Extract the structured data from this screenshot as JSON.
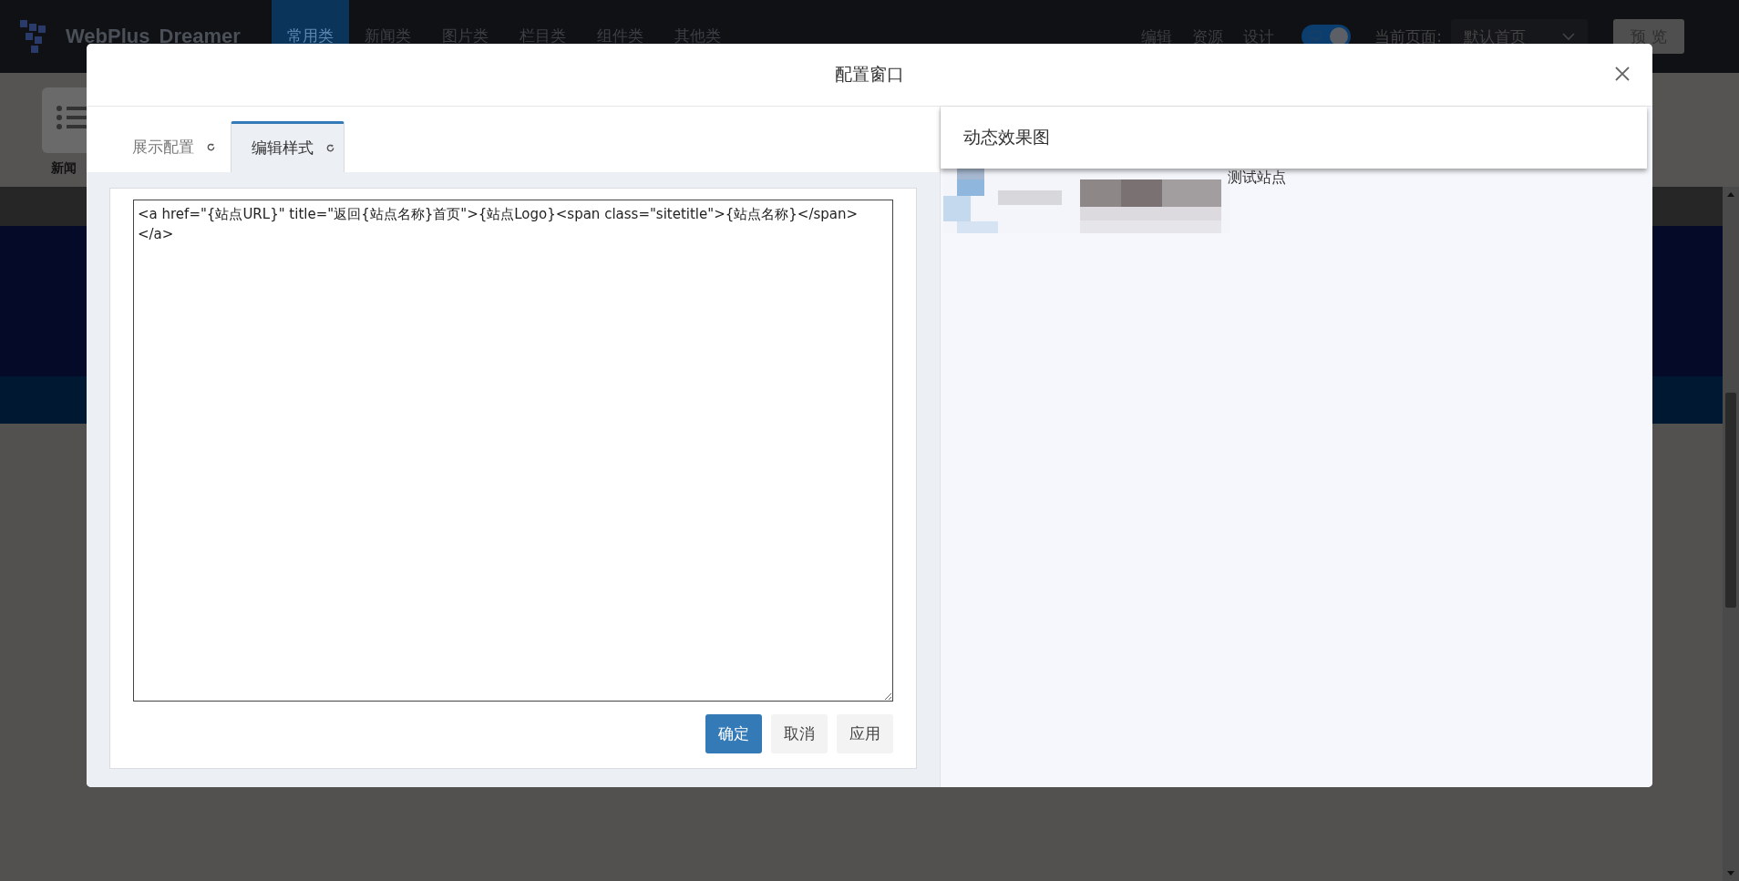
{
  "app_bar": {
    "logo_words": [
      "WebPlus",
      "Dreamer"
    ],
    "nav": [
      {
        "label": "常用类",
        "selected": true
      },
      {
        "label": "新闻类",
        "selected": false
      },
      {
        "label": "图片类",
        "selected": false
      },
      {
        "label": "栏目类",
        "selected": false
      },
      {
        "label": "组件类",
        "selected": false
      },
      {
        "label": "其他类",
        "selected": false
      }
    ],
    "actions": [
      "编辑",
      "资源",
      "设计"
    ],
    "toggle": {
      "on": true
    },
    "page_label": "当前页面:",
    "page_select": "默认首页",
    "preview_button": "预 览"
  },
  "widget_tiles": [
    {
      "label": "新闻"
    }
  ],
  "dialog": {
    "title": "配置窗口",
    "tabs": [
      {
        "label": "展示配置",
        "selected": false
      },
      {
        "label": "编辑样式",
        "selected": true
      }
    ],
    "code": "<a href=\"{站点URL}\" title=\"返回{站点名称}首页\">{站点Logo}<span class=\"sitetitle\">{站点名称}</span></a>",
    "buttons": [
      {
        "label": "确定",
        "kind": "primary"
      },
      {
        "label": "取消",
        "kind": "default"
      },
      {
        "label": "应用",
        "kind": "default"
      }
    ],
    "preview": {
      "title": "动态效果图",
      "site_name": "测试站点"
    }
  }
}
